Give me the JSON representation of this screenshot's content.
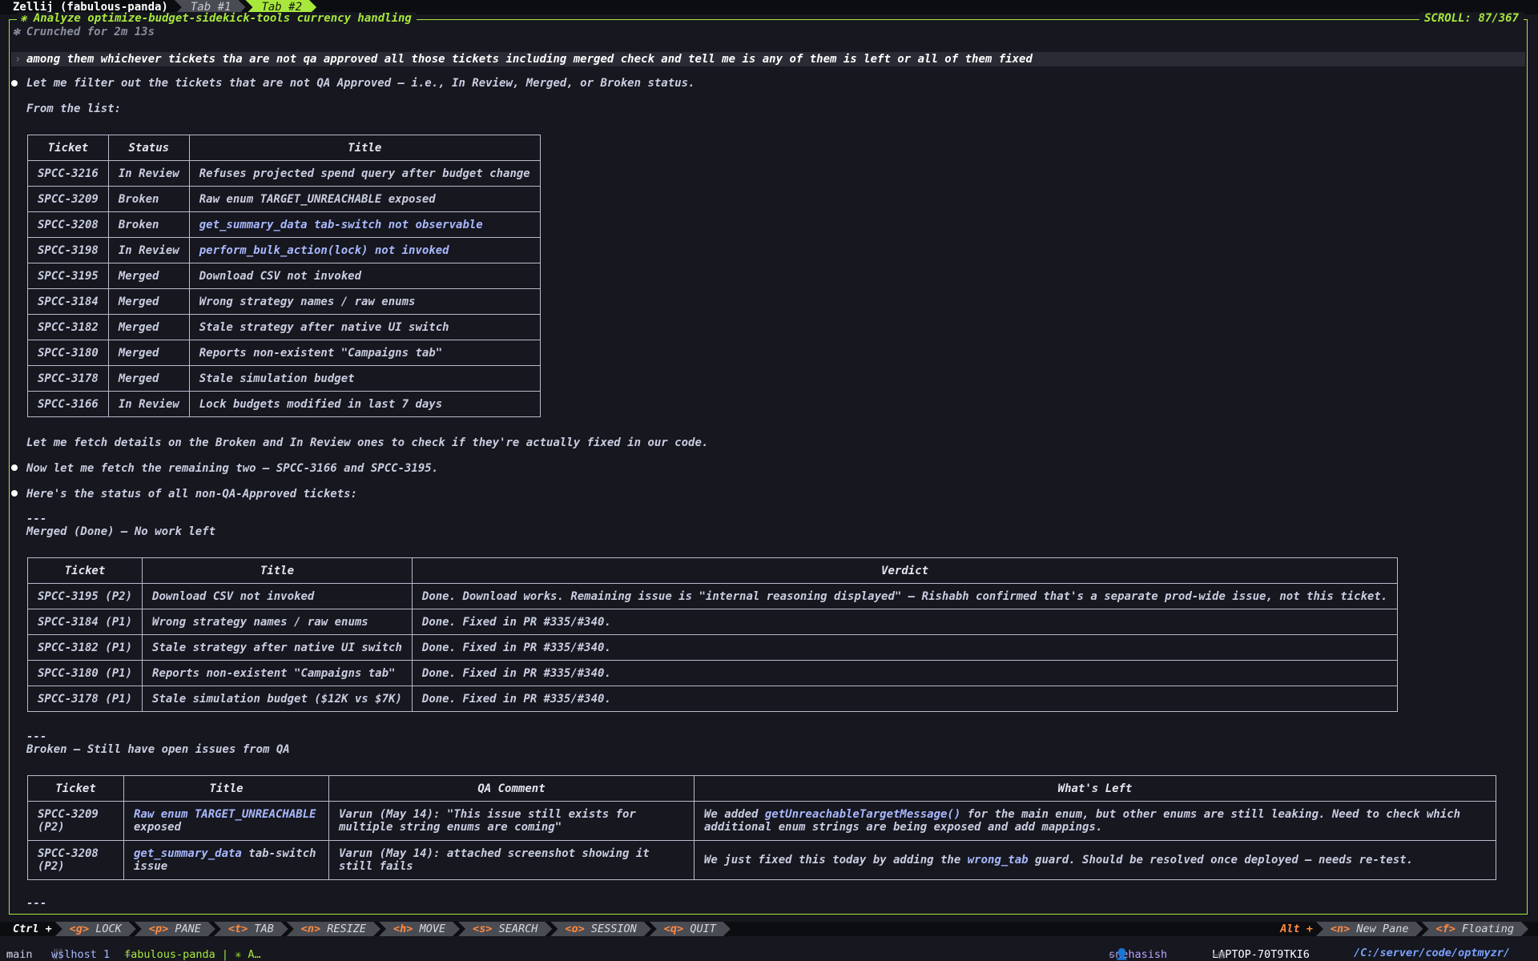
{
  "topbar": {
    "session_label": "Zellij (fabulous-panda)",
    "tabs": [
      {
        "label": "Tab #1",
        "active": false
      },
      {
        "label": "Tab #2",
        "active": true
      }
    ]
  },
  "pane": {
    "title": "✳ Analyze optimize-budget-sidekick-tools currency handling",
    "scroll": "SCROLL:  87/367"
  },
  "conversation": {
    "crunched": "✻ Crunched for 2m 13s",
    "prompt_marker": "›",
    "prompt": "among them whichever tickets tha are not qa approved all those tickets including merged  check and tell me is any of them is left or all of them fixed",
    "msg1": "Let me filter out the tickets that are not QA Approved — i.e., In Review, Merged, or Broken status.",
    "from_list": "From the list:",
    "msg_fetch": "Let me fetch details on the Broken and In Review ones to check if they're actually fixed in our code.",
    "msg2": "Now let me fetch the remaining two — SPCC-3166 and SPCC-3195.",
    "msg3": "Here's the status of all non-QA-Approved tickets:",
    "rule": "---",
    "merged_heading": "Merged (Done) — No work left",
    "broken_heading": "Broken — Still have open issues from QA"
  },
  "ticket_table": {
    "headers": [
      "Ticket",
      "Status",
      "Title"
    ],
    "rows": [
      [
        "SPCC-3216",
        "In Review",
        "Refuses projected spend query after budget change"
      ],
      [
        "SPCC-3209",
        "Broken",
        "Raw enum TARGET_UNREACHABLE exposed"
      ],
      [
        "SPCC-3208",
        "Broken",
        "get_summary_data tab-switch not observable"
      ],
      [
        "SPCC-3198",
        "In Review",
        "perform_bulk_action(lock) not invoked"
      ],
      [
        "SPCC-3195",
        "Merged",
        "Download CSV not invoked"
      ],
      [
        "SPCC-3184",
        "Merged",
        "Wrong strategy names / raw enums"
      ],
      [
        "SPCC-3182",
        "Merged",
        "Stale strategy after native UI switch"
      ],
      [
        "SPCC-3180",
        "Merged",
        "Reports non-existent \"Campaigns tab\""
      ],
      [
        "SPCC-3178",
        "Merged",
        "Stale simulation budget"
      ],
      [
        "SPCC-3166",
        "In Review",
        "Lock budgets modified in last 7 days"
      ]
    ]
  },
  "merged_table": {
    "headers": [
      "Ticket",
      "Title",
      "Verdict"
    ],
    "rows": [
      [
        "SPCC-3195 (P2)",
        "Download CSV not invoked",
        "Done. Download works. Remaining issue is \"internal reasoning displayed\" — Rishabh confirmed that's a separate prod-wide issue, not this ticket."
      ],
      [
        "SPCC-3184 (P1)",
        "Wrong strategy names / raw enums",
        "Done. Fixed in PR #335/#340."
      ],
      [
        "SPCC-3182 (P1)",
        "Stale strategy after native UI switch",
        "Done. Fixed in PR #335/#340."
      ],
      [
        "SPCC-3180 (P1)",
        "Reports non-existent \"Campaigns tab\"",
        "Done. Fixed in PR #335/#340."
      ],
      [
        "SPCC-3178 (P1)",
        "Stale simulation budget ($12K vs $7K)",
        "Done. Fixed in PR #335/#340."
      ]
    ]
  },
  "broken_table": {
    "headers": [
      "Ticket",
      "Title",
      "QA Comment",
      "What's Left"
    ],
    "rows": [
      {
        "ticket": "SPCC-3209 (P2)",
        "title_code": "Raw enum TARGET_UNREACHABLE",
        "title_rest": " exposed",
        "qa": "Varun (May 14): \"This issue still exists for multiple string enums are coming\"",
        "left_pre": "We added ",
        "left_code": "getUnreachableTargetMessage()",
        "left_post": " for the main enum, but other enums are still leaking. Need to check which additional enum strings are being exposed and add mappings."
      },
      {
        "ticket": "SPCC-3208 (P2)",
        "title_code": "get_summary_data",
        "title_rest": " tab-switch issue",
        "qa": "Varun (May 14): attached screenshot showing it still fails",
        "left_pre": "We just fixed this today by adding the ",
        "left_code": "wrong_tab",
        "left_post": " guard. Should be resolved once deployed — needs re-test."
      }
    ]
  },
  "keybar": {
    "ctrl": "Ctrl +",
    "keys": [
      {
        "k": "<g>",
        "label": " LOCK"
      },
      {
        "k": "<p>",
        "label": " PANE"
      },
      {
        "k": "<t>",
        "label": " TAB"
      },
      {
        "k": "<n>",
        "label": " RESIZE"
      },
      {
        "k": "<h>",
        "label": " MOVE"
      },
      {
        "k": "<s>",
        "label": " SEARCH"
      },
      {
        "k": "<o>",
        "label": " SESSION"
      },
      {
        "k": "<q>",
        "label": " QUIT"
      }
    ],
    "alt": "Alt +",
    "alt_keys": [
      {
        "k": "<n>",
        "label": " New Pane"
      },
      {
        "k": "<f>",
        "label": " Floating"
      }
    ]
  },
  "statusline": {
    "branch": "main",
    "host": "wslhost 1",
    "session": "fabulous-panda | ✳ A…",
    "user": "snehasish",
    "machine": "LAPTOP-70T9TKI6",
    "path": "/C:/server/code/optmyzr/"
  },
  "colors": {
    "accent": "#a8e83c",
    "background": "#16171f",
    "key_highlight": "#ff8a3d",
    "code": "#a9b8ff"
  }
}
